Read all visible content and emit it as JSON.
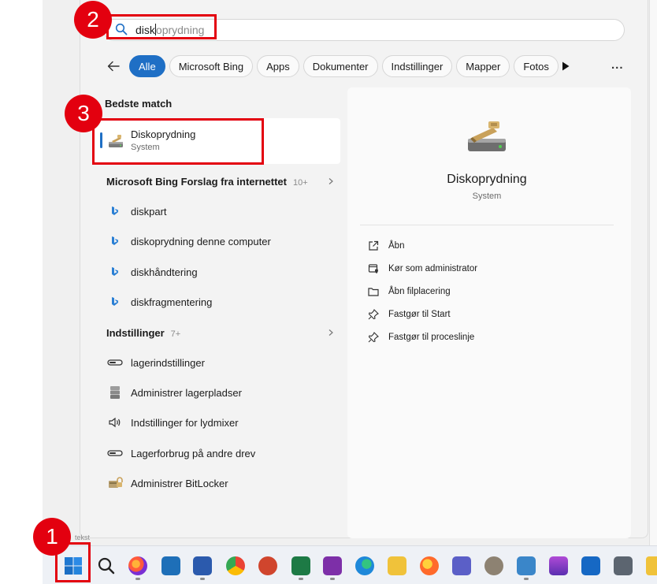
{
  "search": {
    "typed": "disk",
    "suggestion": "oprydning"
  },
  "filters": {
    "back_label": "back",
    "chips": [
      "Alle",
      "Microsoft Bing",
      "Apps",
      "Dokumenter",
      "Indstillinger",
      "Mapper",
      "Fotos"
    ],
    "active": "Alle",
    "more": "..."
  },
  "best_match": {
    "heading": "Bedste match",
    "name": "Diskoprydning",
    "sub": "System"
  },
  "bing": {
    "heading": "Microsoft Bing Forslag fra internettet",
    "count": "10+",
    "items": [
      "diskpart",
      "diskoprydning denne computer",
      "diskhåndtering",
      "diskfragmentering"
    ]
  },
  "settings": {
    "heading": "Indstillinger",
    "count": "7+",
    "items": [
      "lagerindstillinger",
      "Administrer lagerpladser",
      "Indstillinger for lydmixer",
      "Lagerforbrug på andre drev",
      "Administrer BitLocker"
    ]
  },
  "detail": {
    "title": "Diskoprydning",
    "sub": "System",
    "actions": [
      "Åbn",
      "Kør som administrator",
      "Åbn filplacering",
      "Fastgør til Start",
      "Fastgør til proceslinje"
    ]
  },
  "callouts": [
    "1",
    "2",
    "3"
  ],
  "partial_label": "tekst",
  "colors": {
    "accent": "#1f6fc5",
    "callout": "#e3000f",
    "bing": "#2a7fd4"
  },
  "taskbar_icons": [
    "start-icon",
    "search-icon",
    "firefox-icon",
    "remote-desktop-icon",
    "word-icon",
    "chrome-icon",
    "powerpoint-icon",
    "excel-icon",
    "onenote-icon",
    "edge-icon",
    "file-explorer-icon",
    "firefox-icon",
    "teams-icon",
    "gimp-icon",
    "notepad-icon",
    "stack-icon",
    "outlook-icon",
    "calculator-icon",
    "folder-icon"
  ]
}
